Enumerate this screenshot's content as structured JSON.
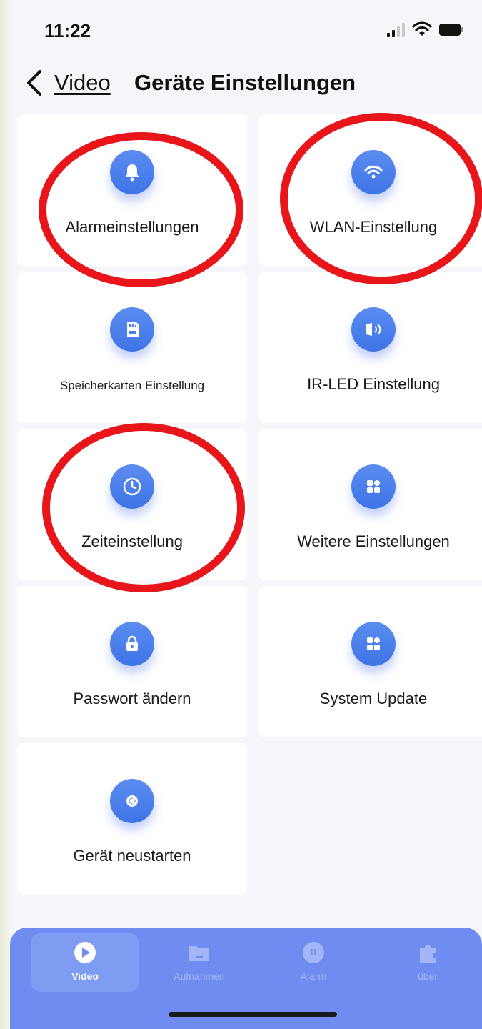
{
  "status_bar": {
    "time": "11:22",
    "icons": [
      "signal-icon",
      "wifi-icon",
      "battery-icon"
    ]
  },
  "nav": {
    "back_label": "Video",
    "title": "Geräte Einstellungen"
  },
  "settings": [
    {
      "label": "Alarmeinstellungen",
      "icon": "bell-icon"
    },
    {
      "label": "WLAN-Einstellung",
      "icon": "wifi-icon"
    },
    {
      "label": "Speicherkarten Einstellung",
      "icon": "sd-card-icon"
    },
    {
      "label": "IR-LED Einstellung",
      "icon": "ir-led-icon"
    },
    {
      "label": "Zeiteinstellung",
      "icon": "clock-icon"
    },
    {
      "label": "Weitere Einstellungen",
      "icon": "grid-icon"
    },
    {
      "label": "Passwort ändern",
      "icon": "lock-icon"
    },
    {
      "label": "System Update",
      "icon": "grid-icon"
    },
    {
      "label": "Gerät neustarten",
      "icon": "restart-icon"
    }
  ],
  "annotations": {
    "color": "#e8151b",
    "circled": [
      "Alarmeinstellungen",
      "WLAN-Einstellung",
      "Zeiteinstellung"
    ]
  },
  "tab_bar": {
    "active": "Video",
    "tabs": [
      {
        "label": "Video",
        "icon": "play-icon"
      },
      {
        "label": "Aufnahmen",
        "icon": "folder-icon"
      },
      {
        "label": "Alarm",
        "icon": "alarm-icon"
      },
      {
        "label": "über",
        "icon": "puzzle-icon"
      }
    ]
  },
  "colors": {
    "accent": "#4a7eea",
    "tab_bar": "#6f8df0",
    "background": "#f5f6f9"
  }
}
